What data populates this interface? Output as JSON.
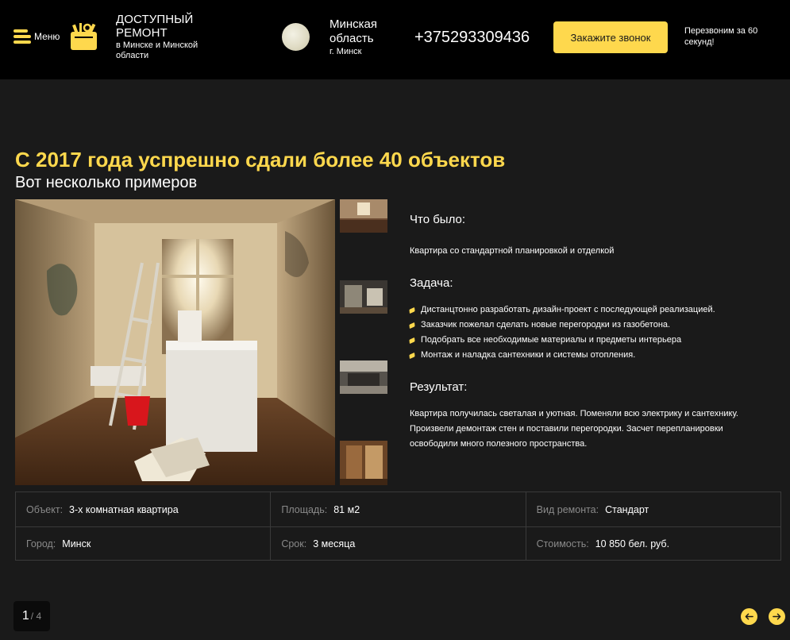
{
  "header": {
    "menu_label": "Меню",
    "brand_title": "ДОСТУПНЫЙ РЕМОНТ",
    "brand_sub": "в Минске и Минской области",
    "region_name": "Минская область",
    "region_city": "г. Минск",
    "phone": "+375293309436",
    "call_button": "Закажите звонок",
    "callback_text": "Перезвоним за 60 секунд!"
  },
  "section": {
    "title": "С 2017 года успрешно сдали более 40 объектов",
    "subtitle": "Вот несколько примеров"
  },
  "project": {
    "before_heading": "Что было:",
    "before_text": "Квартира со стандартной планировкой и отделкой",
    "task_heading": "Задача:",
    "tasks": [
      "Дистанцтонно разработать дизайн-проект с последующей реализацией.",
      "Заказчик пожелал сделать новые перегородки из газобетона.",
      "Подобрать все необходимые материалы и предметы интерьера",
      "Монтаж и наладка сантехники и системы отопления."
    ],
    "result_heading": "Результат:",
    "result_text": "Квартира получилась светалая и уютная. Поменяли всю электрику и сантехнику. Произвели демонтаж стен и поставили перегородки. Засчет перепланировки освободили много полезного пространства."
  },
  "info": {
    "object_label": "Объект:",
    "object_value": "3-х комнатная квартира",
    "area_label": "Площадь:",
    "area_value": "81 м2",
    "type_label": "Вид ремонта:",
    "type_value": "Стандарт",
    "city_label": "Город:",
    "city_value": "Минск",
    "term_label": "Срок:",
    "term_value": "3 месяца",
    "cost_label": "Стоимость:",
    "cost_value": "10 850 бел. руб."
  },
  "pager": {
    "current": "1",
    "total": "/ 4"
  },
  "colors": {
    "accent": "#fed84d",
    "background": "#1a1a1a",
    "header_bg": "#000000",
    "border": "#3a3a3a"
  },
  "icons": [
    "burger-menu-icon",
    "tools-logo-icon",
    "region-globe-icon",
    "arrow-left-icon",
    "arrow-right-icon",
    "list-bullet-icon"
  ]
}
